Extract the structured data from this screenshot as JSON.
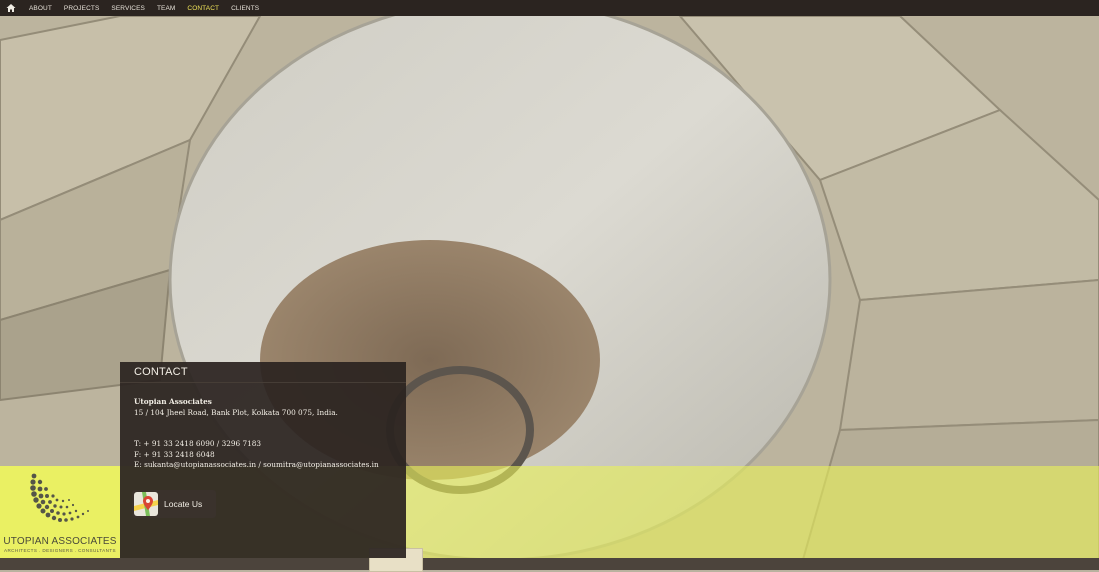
{
  "nav": {
    "home_icon": "home-icon",
    "items": [
      {
        "label": "ABOUT",
        "active": false
      },
      {
        "label": "PROJECTS",
        "active": false
      },
      {
        "label": "SERVICES",
        "active": false
      },
      {
        "label": "TEAM",
        "active": false
      },
      {
        "label": "CONTACT",
        "active": true
      },
      {
        "label": "CLIENTS",
        "active": false
      }
    ],
    "active_color": "#f1e55a"
  },
  "contact": {
    "title": "CONTACT",
    "company": "Utopian Associates",
    "address": "15 / 104 Jheel Road, Bank Plot, Kolkata 700 075, India.",
    "phone": "T: + 91 33 2418 6090 / 3296 7183",
    "fax": "F: + 91 33 2418 6048",
    "email": "E: sukanta@utopianassociates.in / soumitra@utopianassociates.in",
    "locate_label": "Locate Us",
    "locate_icon": "map-pin-icon"
  },
  "logo": {
    "name": "UTOPIAN ASSOCIATES",
    "tagline": "ARCHITECTS . DESIGNERS . CONSULTANTS"
  },
  "colors": {
    "nav_bg": "#2b2420",
    "band": "#e8f05a",
    "panel_bg": "#2b2420"
  }
}
